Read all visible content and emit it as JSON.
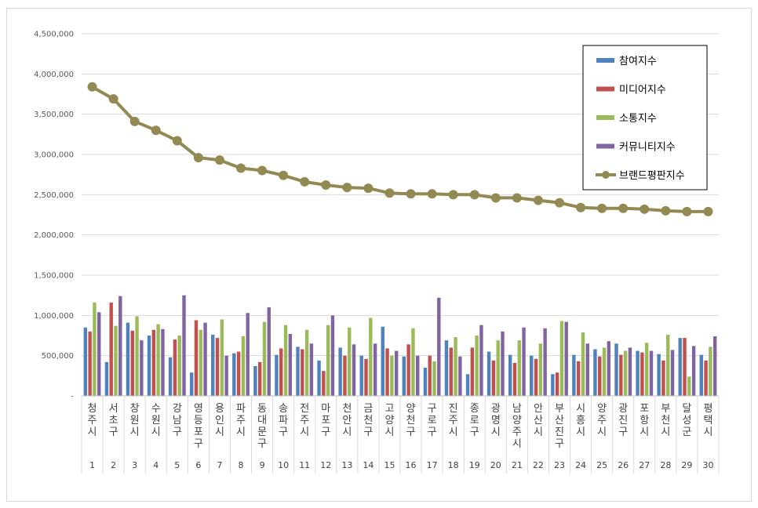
{
  "chart_data": {
    "type": "bar",
    "categories": [
      "청주시",
      "서초구",
      "창원시",
      "수원시",
      "강남구",
      "영등포구",
      "용인시",
      "파주시",
      "동대문구",
      "송파구",
      "전주시",
      "마포구",
      "천안시",
      "금천구",
      "고양시",
      "양천구",
      "구로구",
      "진주시",
      "종로구",
      "광명시",
      "남양주시",
      "안산시",
      "부산진구",
      "시흥시",
      "양주시",
      "광진구",
      "포항시",
      "부천시",
      "달성군",
      "평택시"
    ],
    "ranks": [
      "1",
      "2",
      "3",
      "4",
      "5",
      "6",
      "7",
      "8",
      "9",
      "10",
      "11",
      "12",
      "13",
      "14",
      "15",
      "16",
      "17",
      "18",
      "19",
      "20",
      "21",
      "22",
      "23",
      "24",
      "25",
      "26",
      "27",
      "28",
      "29",
      "30"
    ],
    "series": [
      {
        "name": "참여지수",
        "type": "bar",
        "color": "#4f81bd",
        "values": [
          850000,
          420000,
          910000,
          750000,
          480000,
          290000,
          760000,
          530000,
          370000,
          510000,
          610000,
          440000,
          600000,
          500000,
          860000,
          490000,
          350000,
          690000,
          270000,
          550000,
          510000,
          500000,
          270000,
          510000,
          580000,
          650000,
          560000,
          520000,
          720000,
          510000
        ]
      },
      {
        "name": "미디어지수",
        "type": "bar",
        "color": "#c0504d",
        "values": [
          800000,
          1160000,
          810000,
          820000,
          700000,
          940000,
          720000,
          550000,
          420000,
          590000,
          580000,
          310000,
          500000,
          460000,
          590000,
          640000,
          500000,
          600000,
          600000,
          440000,
          410000,
          460000,
          290000,
          430000,
          490000,
          510000,
          540000,
          440000,
          720000,
          440000
        ]
      },
      {
        "name": "소통지수",
        "type": "bar",
        "color": "#9bbb59",
        "values": [
          1160000,
          870000,
          990000,
          890000,
          750000,
          820000,
          950000,
          740000,
          920000,
          880000,
          820000,
          880000,
          850000,
          970000,
          500000,
          840000,
          430000,
          730000,
          750000,
          690000,
          690000,
          650000,
          930000,
          790000,
          600000,
          560000,
          660000,
          760000,
          240000,
          610000
        ]
      },
      {
        "name": "커뮤니티지수",
        "type": "bar",
        "color": "#8064a2",
        "values": [
          1040000,
          1240000,
          690000,
          830000,
          1250000,
          910000,
          500000,
          1030000,
          1100000,
          770000,
          650000,
          1000000,
          640000,
          650000,
          560000,
          500000,
          1220000,
          490000,
          880000,
          800000,
          850000,
          840000,
          920000,
          650000,
          680000,
          600000,
          560000,
          570000,
          620000,
          740000
        ]
      },
      {
        "name": "브랜드평판지수",
        "type": "line",
        "color": "#938953",
        "values": [
          3840000,
          3690000,
          3410000,
          3300000,
          3170000,
          2960000,
          2930000,
          2830000,
          2800000,
          2740000,
          2660000,
          2620000,
          2590000,
          2580000,
          2520000,
          2510000,
          2510000,
          2500000,
          2500000,
          2460000,
          2460000,
          2430000,
          2400000,
          2340000,
          2330000,
          2330000,
          2320000,
          2300000,
          2290000,
          2290000
        ]
      }
    ],
    "yticks": [
      "-",
      "500,000",
      "1,000,000",
      "1,500,000",
      "2,000,000",
      "2,500,000",
      "3,000,000",
      "3,500,000",
      "4,000,000",
      "4,500,000"
    ],
    "ylim": [
      0,
      4500000
    ],
    "legend_position": "top-right",
    "grid": true
  }
}
